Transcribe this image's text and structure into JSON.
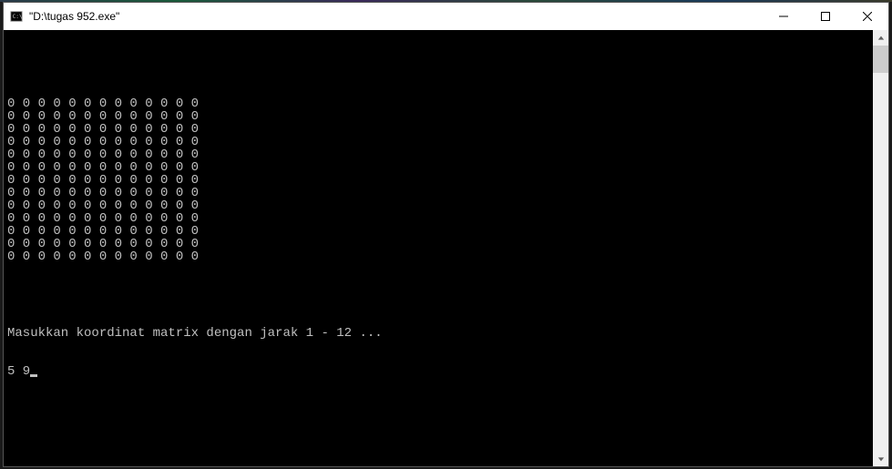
{
  "window": {
    "title": "\"D:\\tugas 952.exe\""
  },
  "console": {
    "matrix_rows": [
      "0 0 0 0 0 0 0 0 0 0 0 0 0",
      "0 0 0 0 0 0 0 0 0 0 0 0 0",
      "0 0 0 0 0 0 0 0 0 0 0 0 0",
      "0 0 0 0 0 0 0 0 0 0 0 0 0",
      "0 0 0 0 0 0 0 0 0 0 0 0 0",
      "0 0 0 0 0 0 0 0 0 0 0 0 0",
      "0 0 0 0 0 0 0 0 0 0 0 0 0",
      "0 0 0 0 0 0 0 0 0 0 0 0 0",
      "0 0 0 0 0 0 0 0 0 0 0 0 0",
      "0 0 0 0 0 0 0 0 0 0 0 0 0",
      "0 0 0 0 0 0 0 0 0 0 0 0 0",
      "0 0 0 0 0 0 0 0 0 0 0 0 0",
      "0 0 0 0 0 0 0 0 0 0 0 0 0"
    ],
    "prompt": "Masukkan koordinat matrix dengan jarak 1 - 12 ...",
    "input": "5 9"
  }
}
